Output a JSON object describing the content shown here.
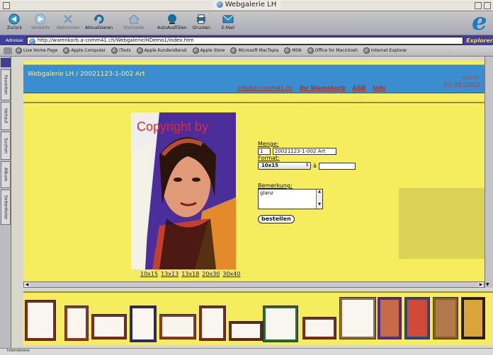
{
  "window": {
    "title": "Webgalerie LH"
  },
  "toolbar": {
    "buttons": [
      {
        "label": "Zurück"
      },
      {
        "label": "Vorwärts"
      },
      {
        "label": "Abbrechen"
      },
      {
        "label": "Aktualisieren"
      },
      {
        "label": "Startseite"
      },
      {
        "label": "AutoAusfüllen"
      },
      {
        "label": "Drucken"
      },
      {
        "label": "E-Mail"
      }
    ]
  },
  "address": {
    "label": "Adresse:",
    "url": "http://warenkorb.a-comm41.ch/Webgalerie/HDemo1/index.htm",
    "brand": "Explorer"
  },
  "favorites": [
    "Live Home Page",
    "Apple Computer",
    "iTools",
    "Apple Kundendienst",
    "Apple Store",
    "Microsoft MacTopia",
    "MSN",
    "Office for Macintosh",
    "Internet Explorer"
  ],
  "sidebar_tabs": [
    "Favoriten",
    "Verlauf",
    "Suchen",
    "Album",
    "Seitenfeiler"
  ],
  "page": {
    "site_title": "Webgalerie LH / 20021123-1-002 Art",
    "nav_links": [
      {
        "label": "info@a-comm41.ch",
        "bold": false
      },
      {
        "label": "Ihr Warenkorb",
        "bold": true
      },
      {
        "label": "AGB",
        "bold": true
      },
      {
        "label": "Info",
        "bold": true
      }
    ],
    "date_small": "Aktuell",
    "date": "07.05.2002",
    "watermark": "Copyright by",
    "sizes": [
      "10x15",
      "13x13",
      "13x18",
      "20x30",
      "30x40"
    ],
    "form": {
      "menge_label": "Menge:",
      "menge_value": "1",
      "art_value": "20021123-1-002 Art",
      "format_label": "Format:",
      "format_value": "10x15",
      "price_prefix": "à",
      "price_value": "",
      "bemerkung_label": "Bemerkung:",
      "bemerkung_value": "glanz",
      "order_button": "bestellen"
    }
  },
  "status": {
    "text": "Internetzone"
  },
  "colors": {
    "page_bg": "#f5ec5e",
    "header_bg": "#3a8ecf",
    "link_red": "#b03020"
  }
}
